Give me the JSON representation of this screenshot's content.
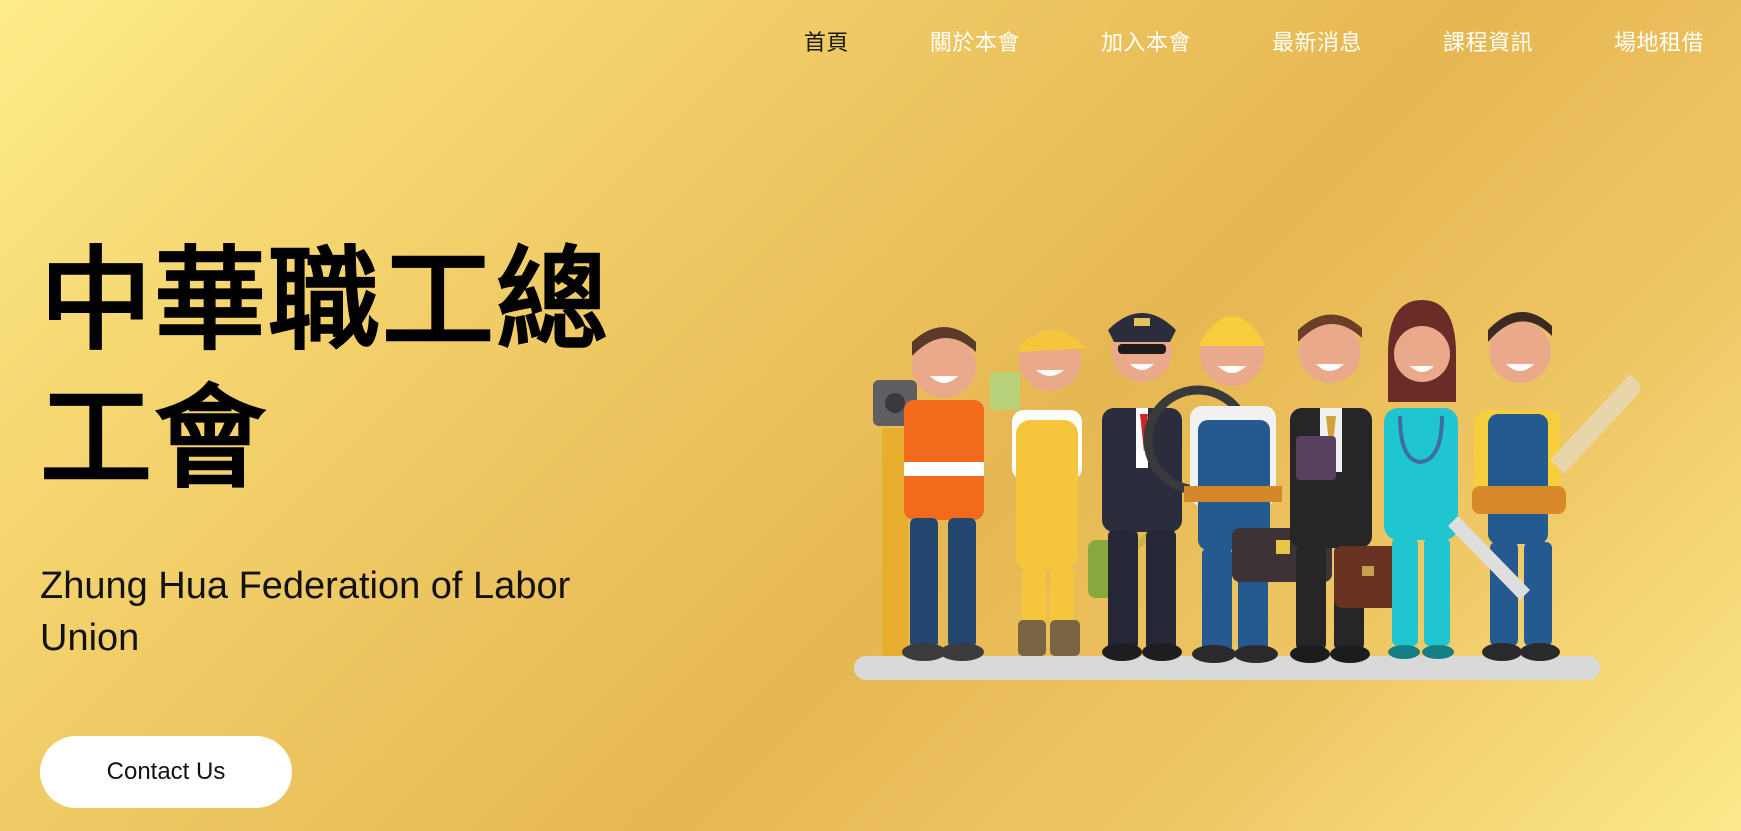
{
  "nav": {
    "items": [
      {
        "label": "首頁",
        "active": true
      },
      {
        "label": "關於本會",
        "active": false
      },
      {
        "label": "加入本會",
        "active": false
      },
      {
        "label": "最新消息",
        "active": false
      },
      {
        "label": "課程資訊",
        "active": false
      },
      {
        "label": "場地租借",
        "active": false
      }
    ]
  },
  "hero": {
    "title_line1": "中華職工總",
    "title_line2": "工會",
    "subtitle": "Zhung Hua Federation of Labor Union",
    "cta_label": "Contact Us"
  },
  "illustration": {
    "icon": "workers-group-illustration",
    "figures": [
      "surveyor",
      "safety-vest-worker",
      "gardener",
      "pilot",
      "construction-worker",
      "businessman",
      "nurse",
      "carpenter"
    ]
  },
  "colors": {
    "background_light": "#fdec8a",
    "background_dark": "#e6b752",
    "nav_text": "#ffffff",
    "nav_active": "#1a1a1a",
    "button_bg": "#ffffff"
  }
}
